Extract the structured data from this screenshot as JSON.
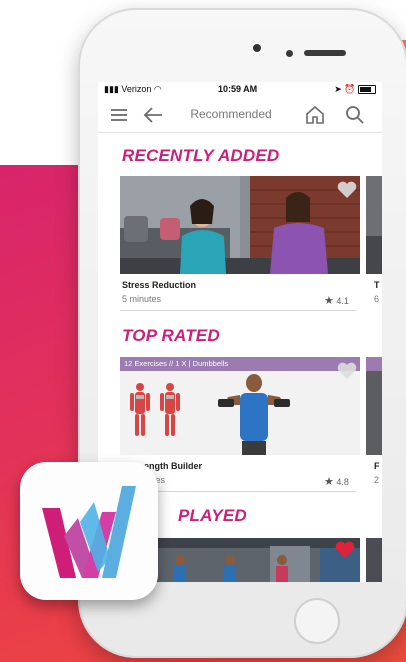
{
  "status": {
    "carrier": "Verizon",
    "time": "10:59 AM"
  },
  "nav": {
    "title": "Recommended"
  },
  "sections": [
    {
      "title": "RECENTLY ADDED",
      "card": {
        "title": "Stress Reduction",
        "duration": "5 minutes",
        "rating": "4.1",
        "favorited": false
      },
      "next_card": {
        "title_fragment": "T",
        "meta_fragment": "6"
      }
    },
    {
      "title": "TOP RATED",
      "card": {
        "banner": "12 Exercises // 1 X | Dumbbells",
        "title": "Strength Builder",
        "title_visible": "ength Builder",
        "duration_visible": "utes",
        "rating": "4.8",
        "favorited": false
      },
      "next_card": {
        "title_fragment": "F",
        "meta_fragment": "2"
      }
    },
    {
      "title_visible": "PLAYED",
      "card": {
        "favorited": true
      }
    }
  ],
  "colors": {
    "accent": "#cf1e78",
    "heart_active": "#e0213a",
    "heart_inactive": "#dddddd",
    "background_gradient_start": "#d8246b",
    "background_gradient_end": "#ef4a3a"
  },
  "icons": {
    "menu": "hamburger",
    "back": "arrow-left",
    "home": "house",
    "search": "magnifier",
    "star": "star",
    "heart": "heart"
  }
}
